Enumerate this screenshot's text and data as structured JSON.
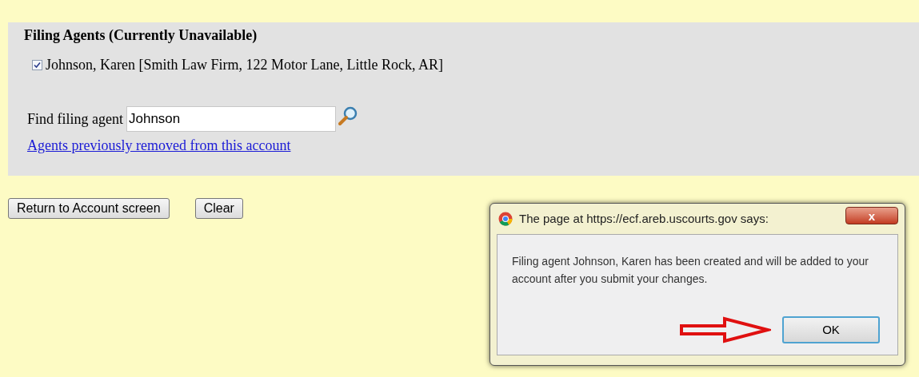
{
  "section": {
    "title": "Filing Agents (Currently Unavailable)",
    "agents": [
      {
        "label": "Johnson, Karen [Smith Law Firm, 122 Motor Lane, Little Rock, AR]",
        "checked": true
      }
    ],
    "search": {
      "label": "Find filing agent",
      "value": "Johnson"
    },
    "link": "Agents previously removed from this account"
  },
  "buttons": [
    "Return to Account screen",
    "Clear"
  ],
  "dialog": {
    "title": "The page at https://ecf.areb.uscourts.gov says:",
    "close": "x",
    "message": "Filing agent Johnson, Karen has been created and will be added to your account after you submit your changes.",
    "ok": "OK"
  }
}
